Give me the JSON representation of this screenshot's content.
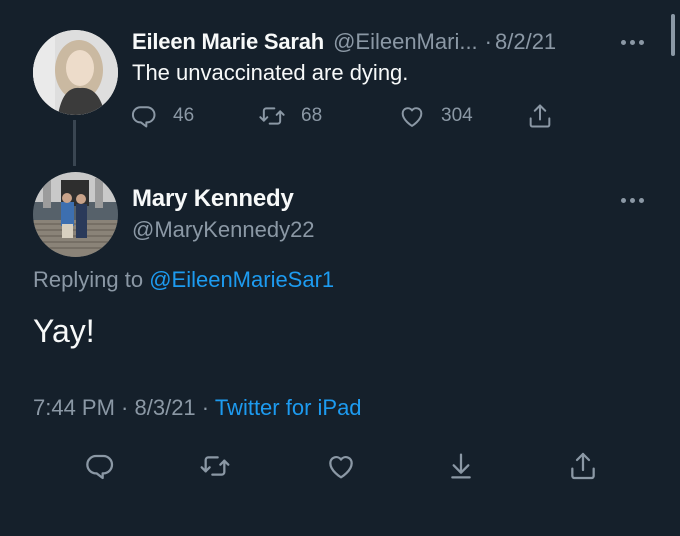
{
  "parent_tweet": {
    "author_name": "Eileen Marie Sarah",
    "handle": "@EileenMari...",
    "date_separator": "·",
    "date": "8/2/21",
    "text": "The unvaccinated are dying.",
    "counts": {
      "replies": "46",
      "retweets": "68",
      "likes": "304"
    }
  },
  "reply_tweet": {
    "author_name": "Mary Kennedy",
    "handle": "@MaryKennedy22",
    "replying_prefix": "Replying to ",
    "replying_to": "@EileenMarieSar1",
    "text": "Yay!",
    "time": "7:44 PM",
    "separator_1": " · ",
    "date": "8/3/21",
    "separator_2": " · ",
    "source": "Twitter for iPad"
  },
  "icons": {
    "reply": "reply-icon",
    "retweet": "retweet-icon",
    "like": "heart-icon",
    "share": "share-icon",
    "bookmark": "download-icon",
    "more": "more-icon"
  },
  "colors": {
    "background": "#15202b",
    "primary_text": "#f7f9f9",
    "secondary_text": "#8b98a5",
    "link": "#1d9bf0"
  }
}
